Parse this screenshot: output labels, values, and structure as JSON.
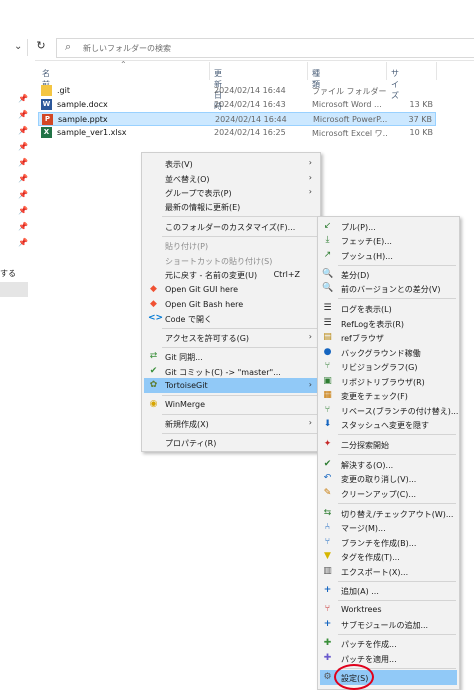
{
  "toolbar": {
    "search_placeholder": "新しいフォルダーの検索"
  },
  "nav": {
    "fragment": "する"
  },
  "columns": {
    "name": "名前",
    "date": "更新日時",
    "type": "種類",
    "size": "サイズ"
  },
  "files": [
    {
      "name": ".git",
      "date": "2024/02/14 16:44",
      "type": "ファイル フォルダー",
      "size": "",
      "icon": "folder-icon",
      "color": "#f4c542"
    },
    {
      "name": "sample.docx",
      "date": "2024/02/14 16:43",
      "type": "Microsoft Word ...",
      "size": "13 KB",
      "icon": "word-icon",
      "color": "#2b579a"
    },
    {
      "name": "sample.pptx",
      "date": "2024/02/14 16:44",
      "type": "Microsoft PowerP...",
      "size": "37 KB",
      "icon": "powerpoint-icon",
      "color": "#d24726"
    },
    {
      "name": "sample_ver1.xlsx",
      "date": "2024/02/14 16:25",
      "type": "Microsoft Excel ワ...",
      "size": "10 KB",
      "icon": "excel-icon",
      "color": "#217346"
    }
  ],
  "context_menu": {
    "view": "表示(V)",
    "sort": "並べ替え(O)",
    "group": "グループで表示(P)",
    "refresh": "最新の情報に更新(E)",
    "customize": "このフォルダーのカスタマイズ(F)...",
    "paste": "貼り付け(P)",
    "paste_shortcut": "ショートカットの貼り付け(S)",
    "undo": "元に戻す - 名前の変更(U)",
    "undo_shortcut": "Ctrl+Z",
    "git_gui": "Open Git GUI here",
    "git_bash": "Open Git Bash here",
    "vscode": "Code で開く",
    "access": "アクセスを許可する(G)",
    "git_sync": "Git 同期...",
    "git_commit": "Git コミット(C) -> \"master\"...",
    "tortoisegit": "TortoiseGit",
    "winmerge": "WinMerge",
    "new": "新規作成(X)",
    "properties": "プロパティ(R)"
  },
  "submenu": {
    "pull": "プル(P)...",
    "fetch": "フェッチ(E)...",
    "push": "プッシュ(H)...",
    "diff": "差分(D)",
    "diff_prev": "前のバージョンとの差分(V)",
    "log": "ログを表示(L)",
    "reflog": "RefLogを表示(R)",
    "ref_browser": "refブラウザ",
    "daemon": "バックグラウンド稼働",
    "revgraph": "リビジョングラフ(G)",
    "repo_browser": "リポジトリブラウザ(R)",
    "check_mod": "変更をチェック(F)",
    "rebase": "リベース(ブランチの付け替え)...",
    "stash": "スタッシュへ変更を隠す",
    "bisect": "二分探索開始",
    "resolve": "解決する(O)...",
    "revert": "変更の取り消し(V)...",
    "cleanup": "クリーンアップ(C)...",
    "switch": "切り替え/チェックアウト(W)...",
    "merge": "マージ(M)...",
    "branch": "ブランチを作成(B)...",
    "tag": "タグを作成(T)...",
    "export": "エクスポート(X)...",
    "add": "追加(A) ...",
    "worktrees": "Worktrees",
    "submodule": "サブモジュールの追加...",
    "create_patch": "パッチを作成...",
    "apply_patch": "パッチを適用...",
    "settings": "設定(S)"
  },
  "colors": {
    "highlight": "#91c9f7",
    "selection": "#cce8ff",
    "annotation": "#e0001b"
  }
}
